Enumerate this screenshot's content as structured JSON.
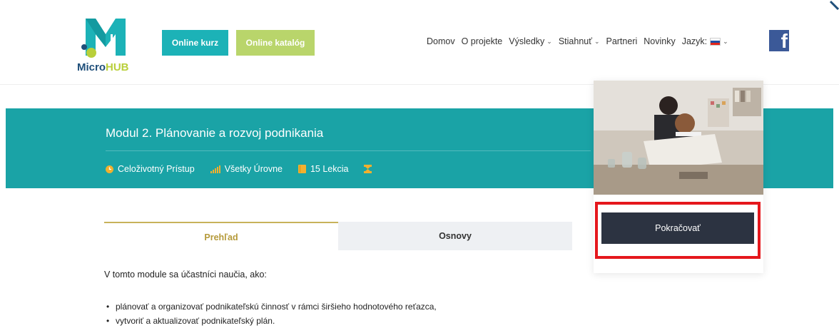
{
  "header": {
    "logo_text_a": "Micro",
    "logo_text_b": "HUB",
    "btn_online_kurz": "Online kurz",
    "btn_online_katalog": "Online katalóg",
    "nav": [
      {
        "label": "Domov",
        "dropdown": false
      },
      {
        "label": "O projekte",
        "dropdown": false
      },
      {
        "label": "Výsledky",
        "dropdown": true
      },
      {
        "label": "Stiahnuť",
        "dropdown": true
      },
      {
        "label": "Partneri",
        "dropdown": false
      },
      {
        "label": "Novinky",
        "dropdown": false
      }
    ],
    "language_label": "Jazyk:",
    "facebook_glyph": "f"
  },
  "course": {
    "title": "Modul 2. Plánovanie a rozvoj podnikania",
    "meta": {
      "access": "Celoživotný Prístup",
      "level": "Všetky Úrovne",
      "lessons": "15 Lekcia"
    }
  },
  "tabs": {
    "overview": "Prehľad",
    "curriculum": "Osnovy",
    "active": "overview"
  },
  "content": {
    "intro": "V tomto module sa účastníci naučia, ako:",
    "bullets": [
      "plánovať a organizovať podnikateľskú činnosť v rámci širšieho hodnotového reťazca,",
      "vytvoriť a aktualizovať podnikateľský plán."
    ]
  },
  "sidebar": {
    "continue_label": "Pokračovať"
  },
  "colors": {
    "teal": "#1aa3a6",
    "button_teal": "#1cb2b7",
    "button_green": "#b9d56b",
    "gold": "#c8b25a",
    "dark_button": "#2c3341",
    "highlight_red": "#e5171c",
    "facebook": "#3b5998"
  },
  "icons": [
    "clock-icon",
    "signal-bars-icon",
    "book-icon",
    "certificate-icon",
    "chevron-down-icon",
    "flag-sk-icon",
    "facebook-icon"
  ]
}
